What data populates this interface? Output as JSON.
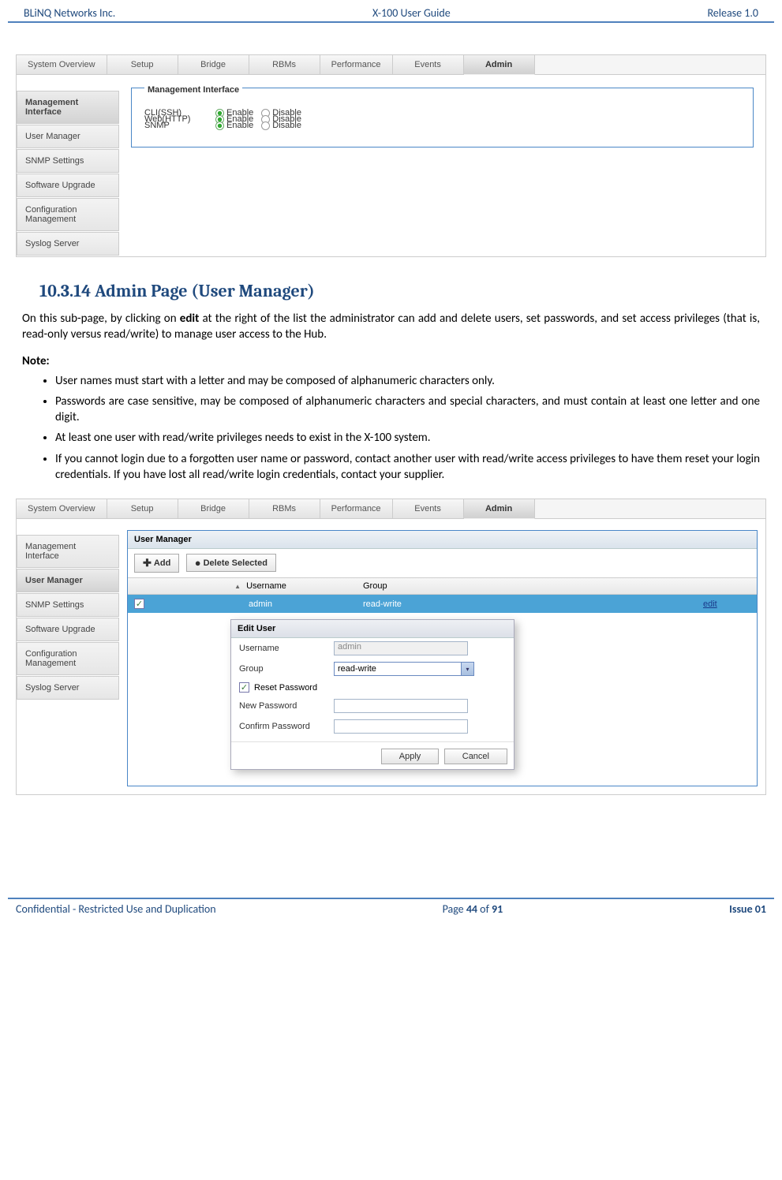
{
  "header": {
    "left": "BLiNQ Networks Inc.",
    "center": "X-100 User Guide",
    "right": "Release 1.0"
  },
  "footer": {
    "left": "Confidential - Restricted Use and Duplication",
    "page_prefix": "Page ",
    "page_cur": "44",
    "page_of": " of ",
    "page_total": "91",
    "right": "Issue 01"
  },
  "tabs": [
    "System Overview",
    "Setup",
    "Bridge",
    "RBMs",
    "Performance",
    "Events",
    "Admin"
  ],
  "sidebar": [
    "Management Interface",
    "User Manager",
    "SNMP Settings",
    "Software Upgrade",
    "Configuration Management",
    "Syslog Server"
  ],
  "shot1": {
    "legend": "Management Interface",
    "rows": [
      {
        "label": "CLI(SSH)",
        "opt_on": "Enable",
        "opt_off": "Disable"
      },
      {
        "label": "Web(HTTP)",
        "opt_on": "Enable",
        "opt_off": "Disable"
      },
      {
        "label": "SNMP",
        "opt_on": "Enable",
        "opt_off": "Disable"
      }
    ]
  },
  "section": {
    "heading": "10.3.14 Admin Page (User Manager)",
    "intro_a": "On this sub-page, by clicking on ",
    "intro_b": "edit",
    "intro_c": " at the right of the list the administrator can add and delete users, set passwords, and set access privileges (that is, read-only versus read/write) to manage user access to the Hub.",
    "note_label": "Note:",
    "bullets": [
      "User names must start with a letter and may be composed of alphanumeric characters only.",
      "Passwords are case sensitive, may be composed of alphanumeric characters and special characters, and must contain at least one letter and one digit.",
      "At least one user with read/write privileges needs to exist in the X-100 system.",
      "If you cannot login due to a forgotten user name or password, contact another user with read/write access privileges to have them reset your login credentials. If you have lost all read/write login credentials, contact your supplier."
    ]
  },
  "shot2": {
    "panel_title": "User Manager",
    "btn_add": "Add",
    "btn_delete": "Delete Selected",
    "col_user": "Username",
    "col_group": "Group",
    "row_user": "admin",
    "row_group": "read-write",
    "row_edit": "edit",
    "dialog": {
      "title": "Edit User",
      "f_username": "Username",
      "v_username": "admin",
      "f_group": "Group",
      "v_group": "read-write",
      "f_reset": "Reset Password",
      "f_newpw": "New Password",
      "f_confpw": "Confirm Password",
      "btn_apply": "Apply",
      "btn_cancel": "Cancel"
    }
  }
}
